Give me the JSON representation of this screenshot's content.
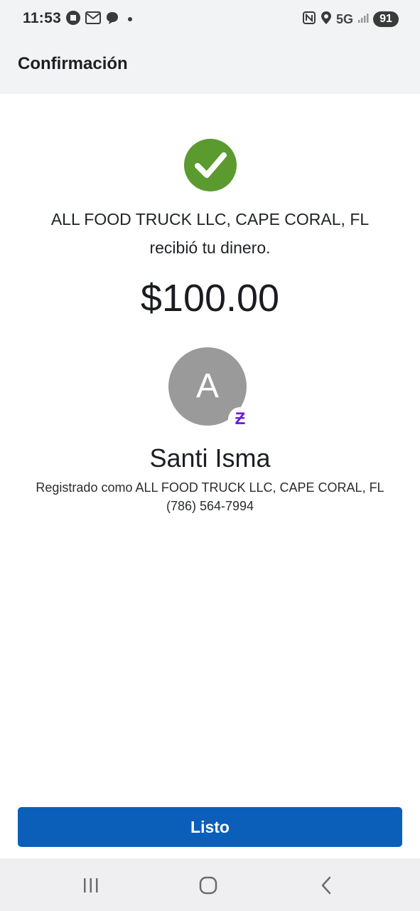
{
  "status_bar": {
    "time": "11:53",
    "network": "5G",
    "battery": "91",
    "left_icons": [
      "chase-icon",
      "gmail-icon",
      "chat-icon",
      "notification-dot-icon"
    ],
    "right_icons": [
      "nfc-icon",
      "location-icon",
      "signal-icon"
    ]
  },
  "header": {
    "title": "Confirmación"
  },
  "confirmation": {
    "recipient": "ALL FOOD TRUCK LLC, CAPE CORAL, FL",
    "message": "recibió tu dinero.",
    "amount": "$100.00",
    "success_color": "#5a9a2e"
  },
  "contact": {
    "avatar_initial": "A",
    "badge_glyph": "Ƶ",
    "name": "Santi Isma",
    "registered_as": "Registrado como ALL FOOD TRUCK LLC, CAPE CORAL, FL",
    "phone": "(786) 564-7994"
  },
  "actions": {
    "done_label": "Listo",
    "button_color": "#0b5fb9"
  },
  "nav_bar": {
    "icons": [
      "recent-apps-icon",
      "home-icon",
      "back-icon"
    ]
  }
}
